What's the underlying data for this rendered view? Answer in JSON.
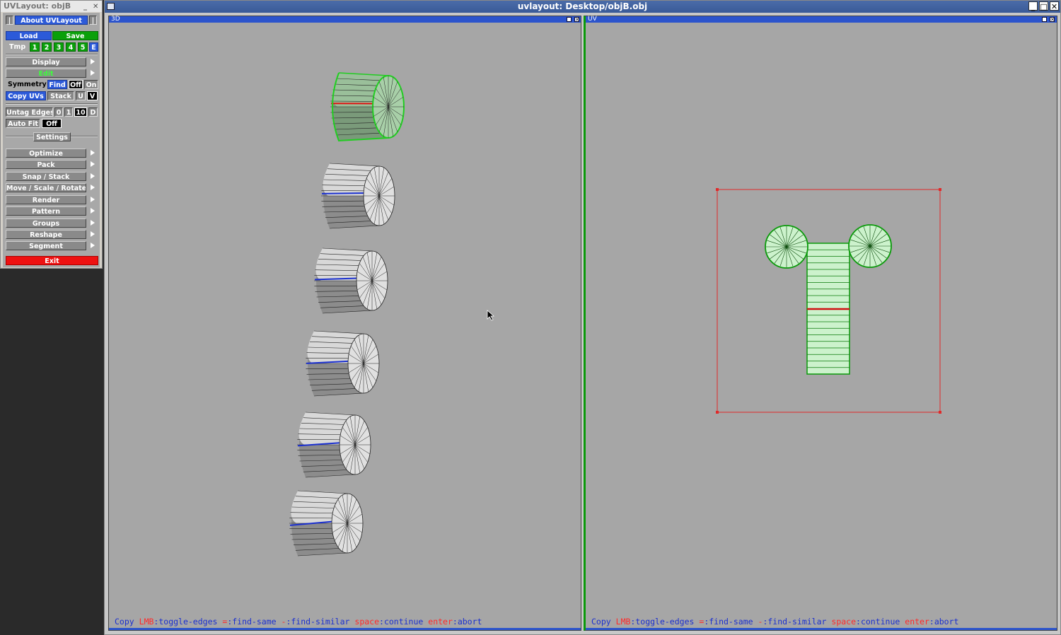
{
  "tool_window": {
    "title": "UVLayout: objB",
    "about": "About UVLayout",
    "load": "Load",
    "save": "Save",
    "tmp": "Tmp",
    "tmp_slots": [
      "1",
      "2",
      "3",
      "4",
      "5",
      "E"
    ],
    "display": "Display",
    "edit": "Edit",
    "symmetry": "Symmetry",
    "find": "Find",
    "off": "Off",
    "on": "On",
    "copy_uvs": "Copy UVs",
    "stack": "Stack",
    "u": "U",
    "v": "V",
    "untag_edges": "Untag Edges",
    "untag_opts": [
      "0",
      "1",
      "10",
      "D"
    ],
    "auto_fit": "Auto Fit",
    "auto_fit_value": "Off",
    "settings": "Settings",
    "menu": [
      "Optimize",
      "Pack",
      "Snap / Stack",
      "Move / Scale / Rotate",
      "Render",
      "Pattern",
      "Groups",
      "Reshape",
      "Segment"
    ],
    "exit": "Exit"
  },
  "main_window": {
    "title": "uvlayout: Desktop/objB.obj",
    "pane3d_label": "3D",
    "paneuv_label": "UV"
  },
  "status_bar": {
    "copy": "Copy",
    "lmb": "LMB",
    "lmb_desc": ":toggle-edges",
    "eq": "=",
    "eq_desc": ":find-same",
    "minus": "-",
    "minus_desc": ":find-similar",
    "space": "space",
    "space_desc": ":continue",
    "enter": "enter",
    "enter_desc": ":abort"
  },
  "colors": {
    "accent_blue": "#2c54cc",
    "green": "#0aa00a",
    "exit_red": "#ee1111",
    "selected_edge": "#e01010",
    "seam_edge": "#1a2fd0"
  }
}
